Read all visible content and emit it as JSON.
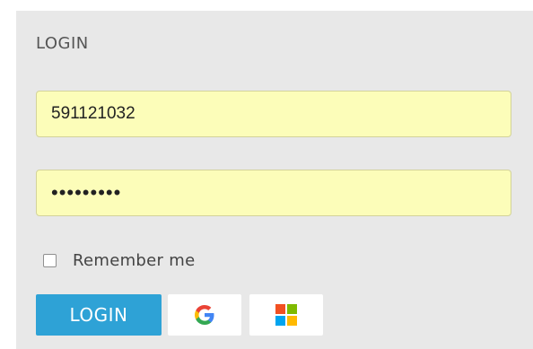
{
  "login": {
    "title": "LOGIN",
    "username_value": "591121032",
    "password_value": "•••••••••",
    "remember_label": "Remember me",
    "remember_checked": false,
    "login_button_label": "LOGIN",
    "social": [
      {
        "provider": "Google",
        "icon": "google-icon"
      },
      {
        "provider": "Microsoft",
        "icon": "microsoft-icon"
      }
    ]
  },
  "colors": {
    "panel_background": "#e8e8e8",
    "input_background": "#fcfdb9",
    "login_button": "#2ea2d6",
    "google_blue": "#4285f4",
    "google_red": "#ea4335",
    "google_yellow": "#fbbc05",
    "google_green": "#34a853",
    "ms_red": "#f25022",
    "ms_green": "#7fba00",
    "ms_blue": "#00a4ef",
    "ms_yellow": "#ffb900"
  }
}
